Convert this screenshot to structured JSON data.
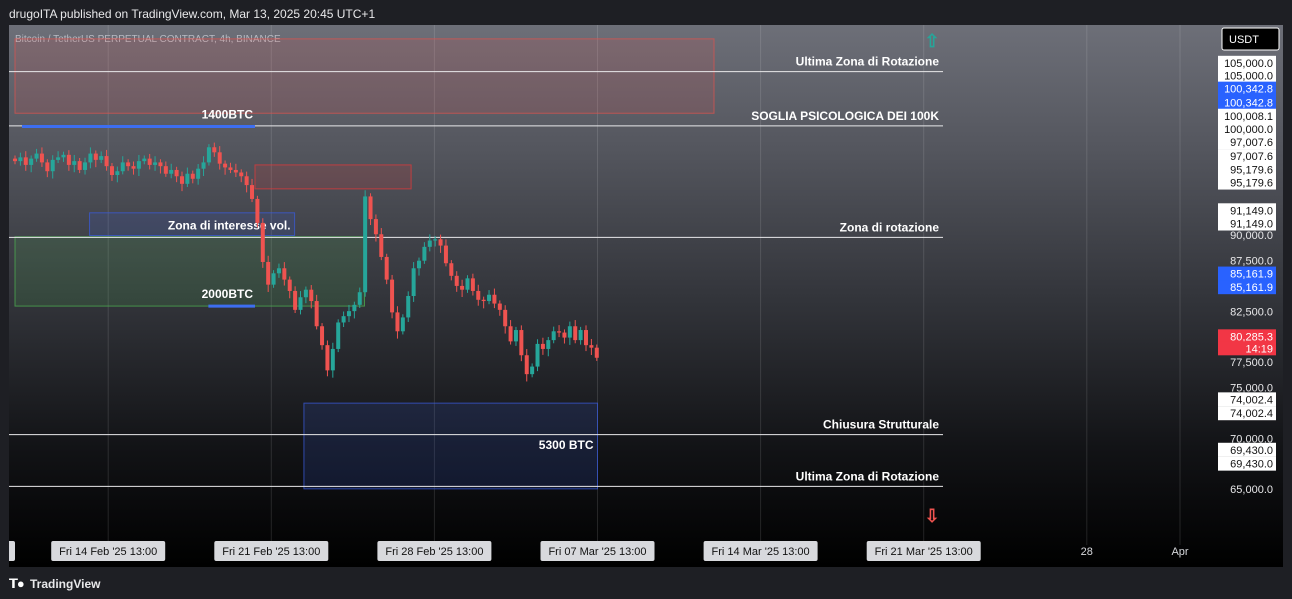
{
  "header": {
    "published_text": "drugoITA published on TradingView.com, Mar 13, 2025 20:45 UTC+1"
  },
  "footer": {
    "logo_text": "TradingView"
  },
  "chart_data": {
    "type": "candlestick",
    "symbol_title": "Bitcoin / TetherUS PERPETUAL CONTRACT, 4h, BINANCE",
    "currency": "USDT",
    "ylim": [
      65000,
      108000
    ],
    "x_ticks": [
      {
        "text": "b '25   13:00",
        "day": 0
      },
      {
        "text": "Fri 14 Feb '25   13:00",
        "day": 4
      },
      {
        "text": "Fri 21 Feb '25   13:00",
        "day": 11
      },
      {
        "text": "Fri 28 Feb '25   13:00",
        "day": 18
      },
      {
        "text": "Fri 07 Mar '25   13:00",
        "day": 25
      },
      {
        "text": "Fri 14 Mar '25   13:00",
        "day": 32
      },
      {
        "text": "Fri 21 Mar '25   13:00",
        "day": 39
      },
      {
        "text": "28",
        "day": 46
      },
      {
        "text": "Apr",
        "day": 50
      }
    ],
    "y_ticks": [
      {
        "text": "105,000.0",
        "value": 105000,
        "style": "white"
      },
      {
        "text": "105,000.0",
        "value": 104000,
        "style": "white"
      },
      {
        "text": "100,342.8",
        "value": 102950,
        "style": "blue"
      },
      {
        "text": "100,342.8",
        "value": 101850,
        "style": "blue"
      },
      {
        "text": "100,008.1",
        "value": 100800,
        "style": "white"
      },
      {
        "text": "100,000.0",
        "value": 99750,
        "style": "white"
      },
      {
        "text": "97,007.6",
        "value": 98700,
        "style": "white"
      },
      {
        "text": "97,007.6",
        "value": 97600,
        "style": "white"
      },
      {
        "text": "95,179.6",
        "value": 96550,
        "style": "white"
      },
      {
        "text": "95,179.6",
        "value": 95500,
        "style": "white"
      },
      {
        "text": "91,149.0",
        "value": 93300,
        "style": "white"
      },
      {
        "text": "91,149.0",
        "value": 92250,
        "style": "white"
      },
      {
        "text": "90,000.0",
        "value": 91350,
        "style": "plain"
      },
      {
        "text": "87,500.0",
        "value": 89330,
        "style": "plain"
      },
      {
        "text": "85,161.9",
        "value": 88280,
        "style": "blue"
      },
      {
        "text": "85,161.9",
        "value": 87200,
        "style": "blue"
      },
      {
        "text": "82,500.0",
        "value": 85290,
        "style": "plain"
      },
      {
        "text": "80,285.3",
        "value": 83300,
        "style": "red"
      },
      {
        "text": "14:19",
        "value": 82350,
        "style": "redsub"
      },
      {
        "text": "77,500.0",
        "value": 81260,
        "style": "plain"
      },
      {
        "text": "75,000.0",
        "value": 79250,
        "style": "plain"
      },
      {
        "text": "74,002.4",
        "value": 78300,
        "style": "white"
      },
      {
        "text": "74,002.4",
        "value": 77200,
        "style": "white"
      },
      {
        "text": "70,000.0",
        "value": 75200,
        "style": "plain"
      },
      {
        "text": "69,430.0",
        "value": 74300,
        "style": "white"
      },
      {
        "text": "69,430.0",
        "value": 73200,
        "style": "white"
      },
      {
        "text": "65,000.0",
        "value": 71200,
        "style": "plain"
      }
    ],
    "horizontal_lines": [
      {
        "value": 104300,
        "label": "Ultima Zona di Rotazione"
      },
      {
        "value": 100000,
        "label": "SOGLIA PSICOLOGICA DEI 100K"
      },
      {
        "value": 91150,
        "label": "Zona di rotazione"
      },
      {
        "value": 75500,
        "label": "Chiusura Strutturale"
      },
      {
        "value": 71400,
        "label": "Ultima Zona di Rotazione"
      }
    ],
    "zones": [
      {
        "name": "resistance-zone",
        "from_day": 0,
        "to_day": 30,
        "y_top": 106900,
        "y_bottom": 101000,
        "color": "#d9534f",
        "label": ""
      },
      {
        "name": "supply-zone",
        "from_day": 10.3,
        "to_day": 17,
        "y_top": 96900,
        "y_bottom": 95000,
        "color": "#e03a3a",
        "label": ""
      },
      {
        "name": "volume-zone",
        "from_day": 3.2,
        "to_day": 12,
        "y_top": 93100,
        "y_bottom": 91300,
        "color": "#3a5bd9",
        "label": "Zona di interesse vol."
      },
      {
        "name": "demand-zone",
        "from_day": 0,
        "to_day": 15,
        "y_top": 91200,
        "y_bottom": 85700,
        "color": "#4caf50",
        "label": ""
      },
      {
        "name": "target-zone",
        "from_day": 12.4,
        "to_day": 25,
        "y_top": 78000,
        "y_bottom": 71200,
        "color": "#3a5bd9",
        "label": "5300 BTC"
      }
    ],
    "volume_lines": [
      {
        "label": "1400BTC",
        "from_day": 0.3,
        "to_day": 10.3,
        "value": 99950
      },
      {
        "label": "2000BTC",
        "from_day": 8.3,
        "to_day": 10.3,
        "value": 85700
      }
    ],
    "day_range": [
      0,
      50
    ],
    "close": [
      97200,
      97500,
      96900,
      97400,
      97800,
      97100,
      96400,
      97300,
      97500,
      97700,
      96900,
      97200,
      96500,
      97100,
      97800,
      97300,
      97600,
      96800,
      96100,
      96400,
      97100,
      96800,
      96600,
      97200,
      97400,
      96900,
      97100,
      96800,
      96200,
      96500,
      96000,
      95400,
      96200,
      95800,
      96600,
      97100,
      98300,
      97900,
      97000,
      96700,
      96500,
      96300,
      96000,
      95300,
      94200,
      92300,
      89200,
      87400,
      88300,
      88700,
      87800,
      86900,
      85400,
      86400,
      87000,
      86100,
      84100,
      82600,
      80600,
      82300,
      84400,
      84900,
      85300,
      85800,
      86800,
      94400,
      92600,
      91400,
      89600,
      87800,
      85200,
      83700,
      84800,
      86500,
      88700,
      89300,
      90400,
      90900,
      91000,
      90500,
      89100,
      88100,
      87300,
      87000,
      87900,
      86900,
      86200,
      86100,
      86600,
      85900,
      85400,
      84100,
      82900,
      83800,
      81800,
      80300,
      80900,
      82700,
      82300,
      83000,
      83700,
      83600,
      83200,
      84100,
      83000,
      83800,
      82600,
      82400,
      81600
    ]
  }
}
